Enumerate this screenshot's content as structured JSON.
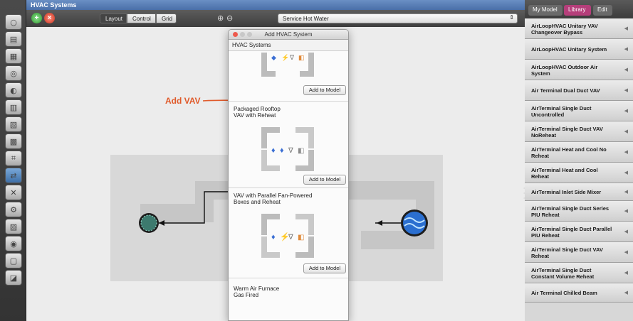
{
  "window": {
    "title": "HVAC Systems"
  },
  "toolbar": {
    "segments": [
      "Layout",
      "Control",
      "Grid"
    ],
    "loop_select": "Service Hot Water",
    "zoom_in_icon": "zoom-in-icon",
    "zoom_out_icon": "zoom-out-icon"
  },
  "left_bar": {
    "tools": [
      "site-icon",
      "schedules-icon",
      "constructions-icon",
      "loads-icon",
      "space-types-icon",
      "geometry-icon",
      "facility-icon",
      "spaces-icon",
      "thermal-zones-icon",
      "hvac-systems-icon",
      "building-summary-icon",
      "outputs-icon",
      "simulation-settings-icon",
      "scripts-icon",
      "run-icon",
      "results-icon"
    ],
    "active_index": 9
  },
  "canvas": {
    "annotation": "Add VAV",
    "colors": {
      "annotation": "#e05a2a",
      "loop": "#d8d8d8"
    }
  },
  "dialog": {
    "title": "Add HVAC System",
    "header": "HVAC Systems",
    "add_label": "Add to Model",
    "systems": [
      {
        "name": ""
      },
      {
        "name": "Packaged Rooftop\nVAV with Reheat"
      },
      {
        "name": "VAV with Parallel Fan-Powered\nBoxes and Reheat"
      },
      {
        "name": "Warm Air Furnace\nGas Fired"
      }
    ]
  },
  "right_panel": {
    "tabs": [
      "My Model",
      "Library",
      "Edit"
    ],
    "active_tab": "Library",
    "items": [
      "AirLoopHVAC Unitary VAV\nChangeover Bypass",
      "AirLoopHVAC Unitary System",
      "AirLoopHVAC Outdoor Air\nSystem",
      "Air Terminal Dual Duct VAV",
      "AirTerminal Single Duct\nUncontrolled",
      "AirTerminal Single Duct VAV\nNoReheat",
      "AirTerminal Heat and Cool No\nReheat",
      "AirTerminal Heat and Cool\nReheat",
      "AirTerminal Inlet Side Mixer",
      "AirTerminal Single Duct Series\nPIU Reheat",
      "AirTerminal Single Duct Parallel\nPIU Reheat",
      "AirTerminal Single Duct VAV\nReheat",
      "AirTerminal Single Duct\nConstant Volume Reheat",
      "Air Terminal Chilled Beam"
    ],
    "colors": {
      "library_tab": "#b53e7a"
    }
  }
}
